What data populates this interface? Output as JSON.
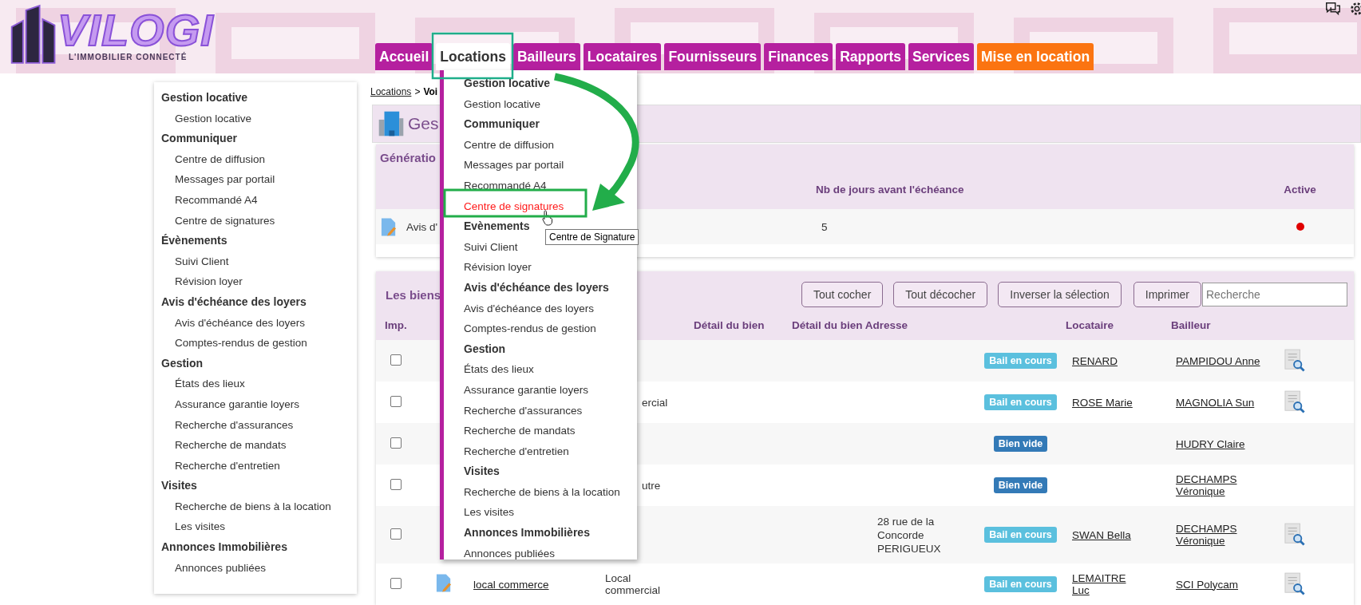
{
  "header": {
    "logo": {
      "name": "VILOGI",
      "tagline": "L'IMMOBILIER CONNECTÉ"
    },
    "nav": [
      {
        "label": "Accueil",
        "selected": false,
        "kind": "standard"
      },
      {
        "label": "Locations",
        "selected": true,
        "kind": "standard"
      },
      {
        "label": "Bailleurs",
        "selected": false,
        "kind": "standard"
      },
      {
        "label": "Locataires",
        "selected": false,
        "kind": "standard"
      },
      {
        "label": "Fournisseurs",
        "selected": false,
        "kind": "standard"
      },
      {
        "label": "Finances",
        "selected": false,
        "kind": "standard"
      },
      {
        "label": "Rapports",
        "selected": false,
        "kind": "standard"
      },
      {
        "label": "Services",
        "selected": false,
        "kind": "standard"
      },
      {
        "label": "Mise en location",
        "selected": false,
        "kind": "promo"
      }
    ]
  },
  "sidebar": {
    "sections": [
      {
        "title": "Gestion locative",
        "children": [
          {
            "label": "Gestion locative"
          }
        ]
      },
      {
        "title": "Communiquer",
        "children": [
          {
            "label": "Centre de diffusion"
          },
          {
            "label": "Messages par portail"
          },
          {
            "label": "Recommandé A4"
          },
          {
            "label": "Centre de signatures"
          }
        ]
      },
      {
        "title": "Évènements",
        "children": [
          {
            "label": "Suivi Client"
          },
          {
            "label": "Révision loyer"
          }
        ]
      },
      {
        "title": "Avis d'échéance des loyers",
        "children": [
          {
            "label": "Avis d'échéance des loyers"
          },
          {
            "label": "Comptes-rendus de gestion"
          }
        ]
      },
      {
        "title": "Gestion",
        "children": [
          {
            "label": "États des lieux"
          },
          {
            "label": "Assurance garantie loyers"
          },
          {
            "label": "Recherche d'assurances"
          },
          {
            "label": "Recherche de mandats"
          },
          {
            "label": "Recherche d'entretien"
          }
        ]
      },
      {
        "title": "Visites",
        "children": [
          {
            "label": "Recherche de biens à la location"
          },
          {
            "label": "Les visites"
          }
        ]
      },
      {
        "title": "Annonces Immobilières",
        "children": [
          {
            "label": "Annonces publiées"
          }
        ]
      }
    ]
  },
  "breadcrumb": {
    "link": "Locations",
    "separator": ">",
    "current": "Voi"
  },
  "title_panel": {
    "title": "Ges"
  },
  "generation_panel": {
    "title": "Génératio",
    "columns": [
      "Nb de jours avant l'échéance",
      "Active"
    ],
    "rows": [
      {
        "label": "Avis d'",
        "days": "5",
        "active": false
      }
    ]
  },
  "properties_panel": {
    "title": "Les biens",
    "buttons": [
      "Tout cocher",
      "Tout décocher",
      "Inverser la sélection",
      "Imprimer"
    ],
    "search": {
      "placeholder": "Recherche"
    },
    "columns": {
      "imp": "Imp.",
      "detail": "Détail du bien",
      "address": "Détail du bien Adresse",
      "tenant": "Locataire",
      "landlord": "Bailleur"
    },
    "rows": [
      {
        "checked": false,
        "status": {
          "label": "Bail en cours",
          "color": "#5bc0de"
        },
        "tenant": "RENARD",
        "landlord": "PAMPIDOU Anne",
        "document": true
      },
      {
        "checked": false,
        "type_tail": "ercial",
        "status": {
          "label": "Bail en cours",
          "color": "#5bc0de"
        },
        "tenant": "ROSE Marie",
        "landlord": "MAGNOLIA Sun",
        "document": true
      },
      {
        "checked": false,
        "status": {
          "label": "Bien vide",
          "color": "#337ab7"
        },
        "landlord": "HUDRY Claire",
        "document": false
      },
      {
        "checked": false,
        "type_tail": "utre",
        "status": {
          "label": "Bien vide",
          "color": "#337ab7"
        },
        "landlord": "DECHAMPS Véronique",
        "document": false
      },
      {
        "checked": false,
        "address": "28 rue de la Concorde PERIGUEUX",
        "status": {
          "label": "Bail en cours",
          "color": "#5bc0de"
        },
        "tenant": "SWAN Bella",
        "landlord": "DECHAMPS Véronique",
        "document": true
      },
      {
        "checked": false,
        "name": "local commerce",
        "type": "Local commercial",
        "status": {
          "label": "Bail en cours",
          "color": "#5bc0de"
        },
        "tenant": "LEMAITRE Luc",
        "landlord": "SCI Polycam",
        "document": true
      }
    ]
  },
  "dropdown": {
    "sections": [
      {
        "title": "Gestion locative",
        "children": [
          {
            "label": "Gestion locative",
            "highlighted": false
          }
        ]
      },
      {
        "title": "Communiquer",
        "children": [
          {
            "label": "Centre de diffusion",
            "highlighted": false
          },
          {
            "label": "Messages par portail",
            "highlighted": false
          },
          {
            "label": "Recommandé A4",
            "highlighted": false
          },
          {
            "label": "Centre de signatures",
            "highlighted": true
          }
        ]
      },
      {
        "title": "Evènements",
        "children": [
          {
            "label": "Suivi Client",
            "highlighted": false
          },
          {
            "label": "Révision loyer",
            "highlighted": false
          }
        ]
      },
      {
        "title": "Avis d'échéance des loyers",
        "children": [
          {
            "label": "Avis d'échéance des loyers",
            "highlighted": false
          },
          {
            "label": "Comptes-rendus de gestion",
            "highlighted": false
          }
        ]
      },
      {
        "title": "Gestion",
        "children": [
          {
            "label": "États des lieux",
            "highlighted": false
          },
          {
            "label": "Assurance garantie loyers",
            "highlighted": false
          },
          {
            "label": "Recherche d'assurances",
            "highlighted": false
          },
          {
            "label": "Recherche de mandats",
            "highlighted": false
          },
          {
            "label": "Recherche d'entretien",
            "highlighted": false
          }
        ]
      },
      {
        "title": "Visites",
        "children": [
          {
            "label": "Recherche de biens à la location",
            "highlighted": false
          },
          {
            "label": "Les visites",
            "highlighted": false
          }
        ]
      },
      {
        "title": "Annonces Immobilières",
        "children": [
          {
            "label": "Annonces publiées",
            "highlighted": false
          }
        ]
      }
    ],
    "tooltip": "Centre de Signature"
  }
}
